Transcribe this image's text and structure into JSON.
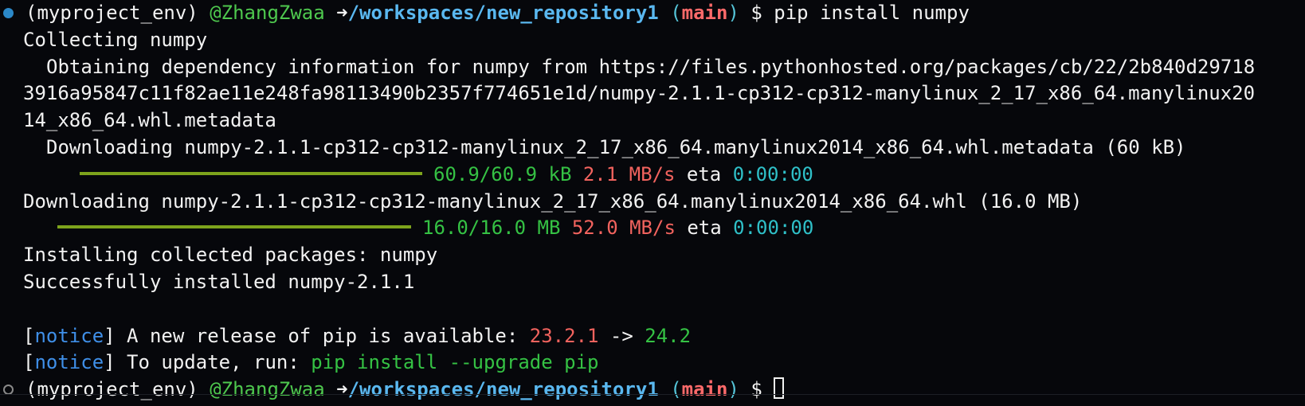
{
  "prompt": {
    "env": "(myproject_env)",
    "user": "@ZhangZwaa",
    "arrow": "➜",
    "path": "/workspaces/new_repository1",
    "branch_open": "(",
    "branch": "main",
    "branch_close": ")",
    "dollar": "$"
  },
  "command": "pip install numpy",
  "output": {
    "collecting": "Collecting numpy",
    "obtaining_1": "Obtaining dependency information for numpy from https://files.pythonhosted.org/packages/cb/22/2b840d29718",
    "obtaining_2": "3916a95847c11f82ae11e248fa98113490b2357f774651e1d/numpy-2.1.1-cp312-cp312-manylinux_2_17_x86_64.manylinux20",
    "obtaining_3": "14_x86_64.whl.metadata",
    "downloading_meta": "Downloading numpy-2.1.1-cp312-cp312-manylinux_2_17_x86_64.manylinux2014_x86_64.whl.metadata (60 kB)",
    "progress1": {
      "size": "60.9/60.9 kB",
      "speed": "2.1 MB/s",
      "eta_label": "eta",
      "eta": "0:00:00",
      "fraction": 1.0
    },
    "downloading_whl": "Downloading numpy-2.1.1-cp312-cp312-manylinux_2_17_x86_64.manylinux2014_x86_64.whl (16.0 MB)",
    "progress2": {
      "size": "16.0/16.0 MB",
      "speed": "52.0 MB/s",
      "eta_label": "eta",
      "eta": "0:00:00",
      "fraction": 1.0
    },
    "installing": "Installing collected packages: numpy",
    "success": "Successfully installed numpy-2.1.1",
    "notice1": {
      "open": "[",
      "tag": "notice",
      "close": "]",
      "text": " A new release of pip is available: ",
      "old": "23.2.1",
      "sep": " -> ",
      "new": "24.2"
    },
    "notice2": {
      "open": "[",
      "tag": "notice",
      "close": "]",
      "text": " To update, run: ",
      "cmd": "pip install --upgrade pip"
    }
  },
  "colors": {
    "background": "#06070b",
    "progress_bar": "#7da31c",
    "green": "#35c244",
    "red": "#f2635e",
    "cyan": "#2fc0c8",
    "path": "#5ab8f0"
  },
  "icons": {
    "prompt_marker_done": "filled-circle",
    "prompt_marker_active": "hollow-circle"
  }
}
